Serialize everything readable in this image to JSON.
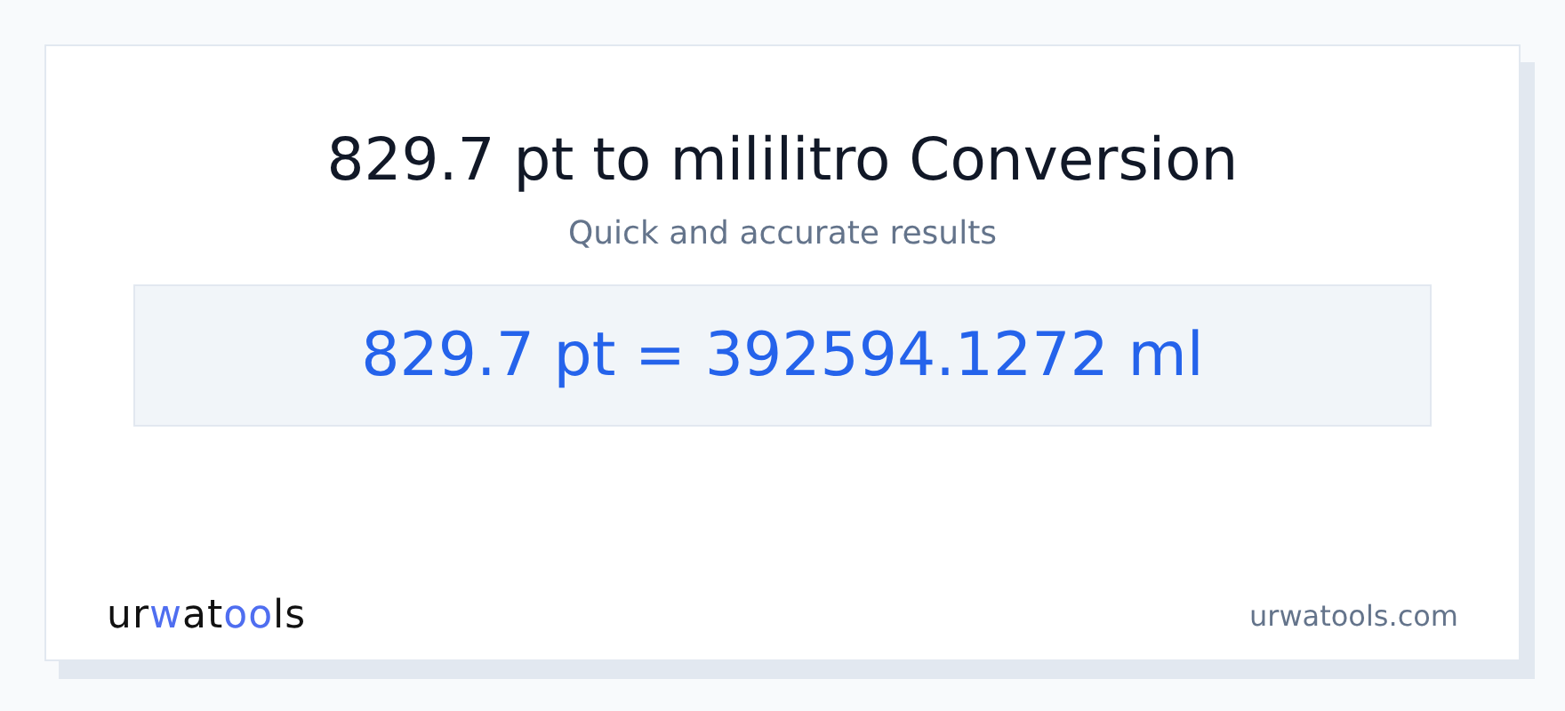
{
  "title": "829.7 pt to mililitro Conversion",
  "subtitle": "Quick and accurate results",
  "result": "829.7 pt = 392594.1272 ml",
  "logo": [
    {
      "text": "ur",
      "accent": false
    },
    {
      "text": "w",
      "accent": true
    },
    {
      "text": "at",
      "accent": false
    },
    {
      "text": "oo",
      "accent": true
    },
    {
      "text": "ls",
      "accent": false
    }
  ],
  "site": "urwatools.com"
}
